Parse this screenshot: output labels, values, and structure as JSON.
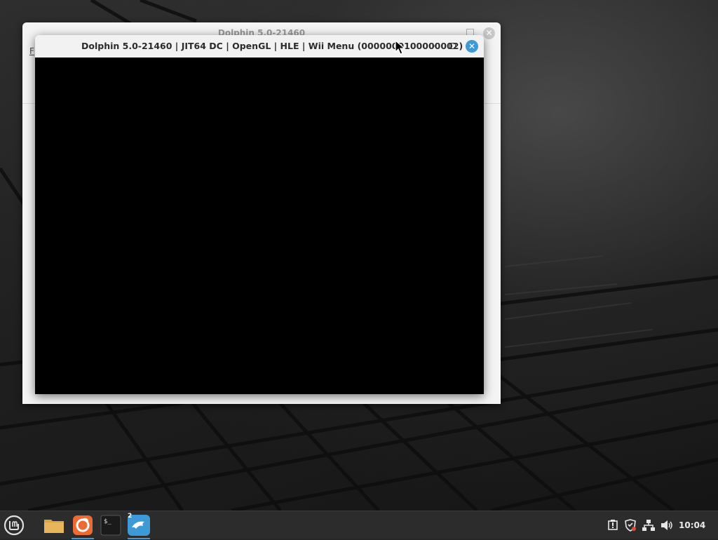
{
  "background_window": {
    "title": "Dolphin 5.0-21460",
    "menu_letter": "F"
  },
  "render_window": {
    "title": "Dolphin 5.0-21460 | JIT64 DC | OpenGL | HLE | Wii Menu (0000000100000002)",
    "minimize_glyph": "–",
    "close_glyph": "✕"
  },
  "taskbar": {
    "items": [
      {
        "name": "mint-menu",
        "icon": "linux-mint-logo"
      },
      {
        "name": "files",
        "icon": "folder-icon"
      },
      {
        "name": "firefox",
        "icon": "firefox-icon",
        "active": true
      },
      {
        "name": "terminal",
        "icon": "terminal-icon"
      },
      {
        "name": "dolphin",
        "icon": "dolphin-icon",
        "active": true,
        "badge": "2"
      }
    ],
    "terminal_glyph": "$_",
    "tray": [
      "update-manager-icon",
      "security-shield-icon",
      "network-icon",
      "volume-icon"
    ],
    "clock": "10:04"
  },
  "colors": {
    "accent": "#3d9ad6",
    "taskbar": "#2c2c2c",
    "folder": "#e8b65a",
    "firefox": "#ec6a33"
  }
}
